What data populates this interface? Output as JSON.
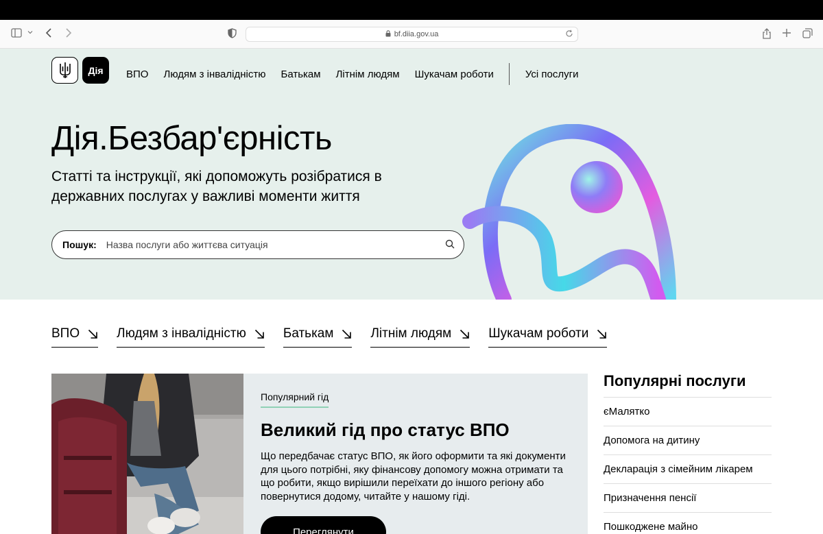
{
  "browser": {
    "url": "bf.diia.gov.ua"
  },
  "header": {
    "logo_text": "Дія",
    "nav": [
      {
        "label": "ВПО"
      },
      {
        "label": "Людям з інвалідністю"
      },
      {
        "label": "Батькам"
      },
      {
        "label": "Літнім людям"
      },
      {
        "label": "Шукачам роботи"
      }
    ],
    "all_services": "Усі послуги"
  },
  "hero": {
    "title": "Дія.Безбар'єрність",
    "subtitle": "Статті та інструкції, які допоможуть розібратися в державних послугах у важливі моменти життя",
    "search_label": "Пошук:",
    "search_placeholder": "Назва послуги або життєва ситуація"
  },
  "categories": [
    {
      "label": "ВПО"
    },
    {
      "label": "Людям з інвалідністю"
    },
    {
      "label": "Батькам"
    },
    {
      "label": "Літнім людям"
    },
    {
      "label": "Шукачам роботи"
    }
  ],
  "guide": {
    "tag": "Популярний гід",
    "title": "Великий гід про статус ВПО",
    "description": "Що передбачає статус ВПО, як його оформити та які документи для цього потрібні, яку фінансову допомогу можна отримати та що робити, якщо вирішили переїхати до іншого регіону або повернутися додому, читайте у нашому гіді.",
    "button": "Переглянути"
  },
  "popular": {
    "title": "Популярні послуги",
    "items": [
      {
        "label": "єМалятко"
      },
      {
        "label": "Допомога на дитину"
      },
      {
        "label": "Декларація з сімейним лікарем"
      },
      {
        "label": "Призначення пенсії"
      },
      {
        "label": "Пошкоджене майно"
      }
    ]
  },
  "colors": {
    "hero_bg": "#e6f0ec",
    "card_bg": "#e7ecee",
    "tag_underline": "#8fd1b5"
  }
}
